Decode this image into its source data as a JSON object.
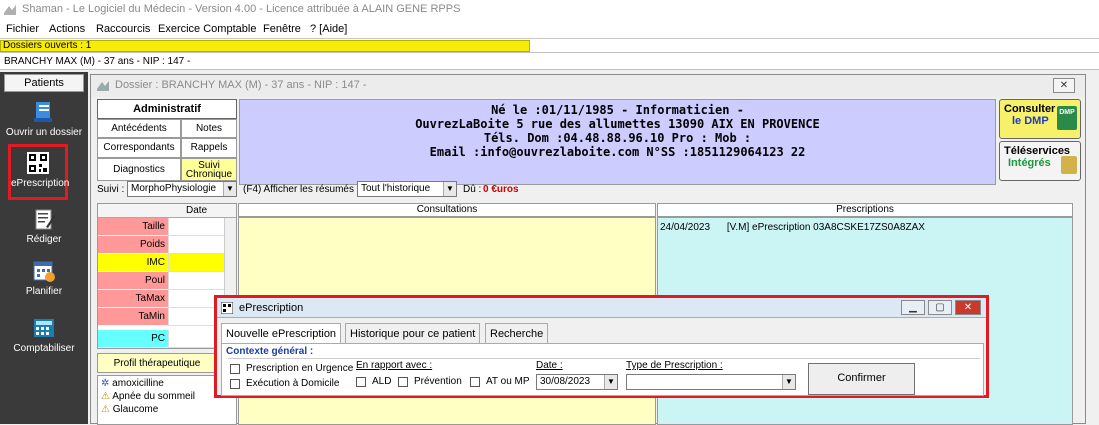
{
  "window": {
    "title": "Shaman - Le Logiciel du Médecin - Version 4.00 - Licence attribuée à ALAIN GENE RPPS"
  },
  "menu": [
    "Fichier",
    "Actions",
    "Raccourcis",
    "Exercice Comptable",
    "Fenêtre",
    "? [Aide]"
  ],
  "dossiers_ouverts": "Dossiers ouverts : 1",
  "patient_line": "BRANCHY MAX (M) - 37 ans - NIP : 147 -",
  "left": {
    "patients_button": "Patients",
    "items": [
      {
        "label": "Ouvrir un dossier",
        "icon": "open-folder-icon"
      },
      {
        "label": "ePrescription",
        "icon": "qr-code-icon"
      },
      {
        "label": "Rédiger",
        "icon": "write-document-icon"
      },
      {
        "label": "Planifier",
        "icon": "calendar-icon"
      },
      {
        "label": "Comptabiliser",
        "icon": "calculator-icon"
      }
    ]
  },
  "dossier": {
    "title": "Dossier : BRANCHY MAX (M) - 37 ans - NIP : 147 -",
    "tabs": {
      "administratif": "Administratif",
      "antecedents": "Antécédents",
      "notes": "Notes",
      "correspondants": "Correspondants",
      "rappels": "Rappels",
      "diagnostics": "Diagnostics",
      "suivi_chronique_1": "Suivi",
      "suivi_chronique_2": "Chronique"
    },
    "info": {
      "line1": "Né le :01/11/1985 - Informaticien -",
      "line2": "OuvrezLaBoite 5 rue des allumettes 13090 AIX EN PROVENCE",
      "line3": "Téls. Dom :04.48.88.96.10 Pro : Mob :",
      "line4": "Email :info@ouvrezlaboite.com N°SS :1851129064123 22"
    },
    "consulter_dmp": {
      "line1": "Consulter",
      "line2": "le DMP",
      "badge": "DMP"
    },
    "teleservices": {
      "line1": "Téléservices",
      "line2": "Intégrés"
    },
    "filter": {
      "suivi_label": "Suivi :",
      "suivi_value": "MorphoPhysiologie",
      "f4_label": "(F4)  Afficher les résumés :",
      "resumes_value": "Tout l'historique",
      "du_label": "Dû :",
      "du_value": "0 €uros"
    },
    "grid": {
      "date_header": "Date",
      "rows": [
        "Taille",
        "Poids",
        "IMC",
        "Poul",
        "TaMax",
        "TaMin",
        "PC"
      ]
    },
    "consultations_header": "Consultations",
    "prescriptions_header": "Prescriptions",
    "prescriptions": [
      {
        "date": "24/04/2023",
        "text": "[V.M] ePrescription 03A8CSKE17ZS0A8ZAX"
      }
    ],
    "profil_button": "Profil thérapeutique",
    "atcd": [
      "amoxicilline",
      "Apnée du sommeil",
      "Glaucome"
    ]
  },
  "eprescription": {
    "title": "ePrescription",
    "tabs": [
      "Nouvelle ePrescription",
      "Historique pour ce patient",
      "Recherche"
    ],
    "context_label": "Contexte général :",
    "urgence": "Prescription en Urgence",
    "domicile": "Exécution à Domicile",
    "rapport_label": "En rapport avec :",
    "ald": "ALD",
    "prevention": "Prévention",
    "at_mp": "AT ou MP",
    "date_label": "Date :",
    "date_value": "30/08/2023",
    "type_label": "Type de Prescription :",
    "type_value": "",
    "confirm": "Confirmer"
  },
  "colors": {
    "red_highlight": "#e01b24",
    "info_bg": "#ccccff",
    "consult_bg": "#ffffc4",
    "presc_bg": "#cbf5f5",
    "grid_pink": "#ff9999",
    "imc_yellow": "#ffff00",
    "pc_cyan": "#66ffff"
  }
}
